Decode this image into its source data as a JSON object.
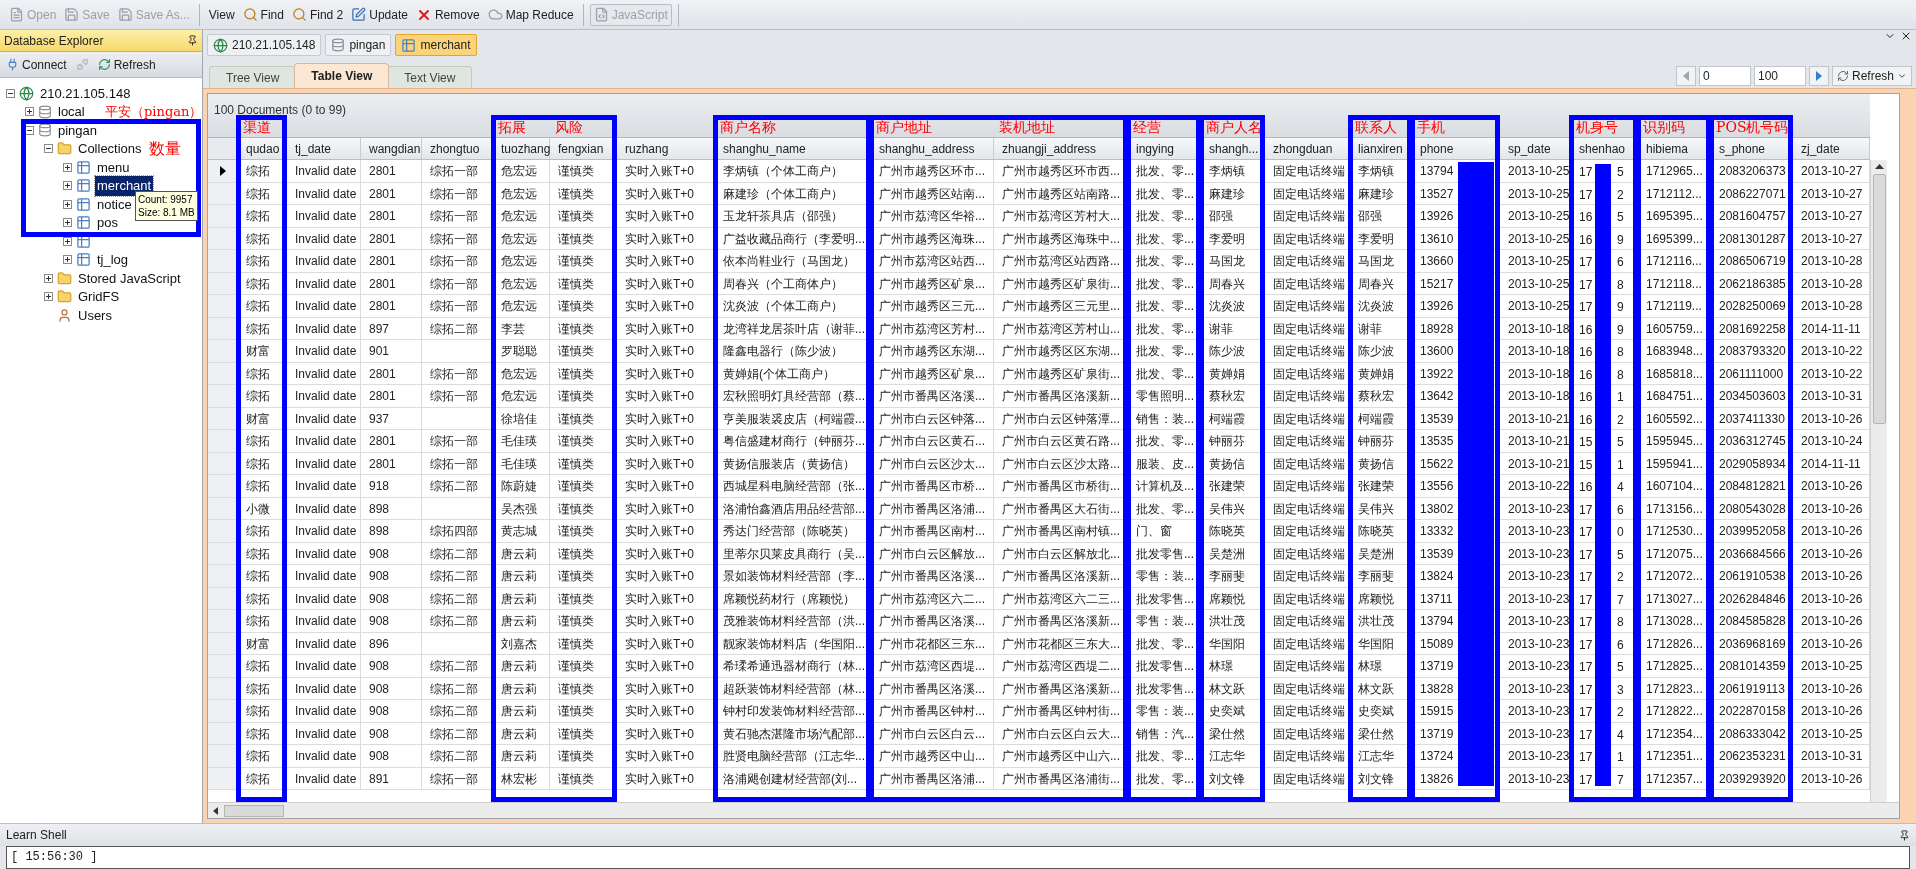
{
  "toolbar": [
    [
      {
        "label": "Open",
        "kind": "open",
        "disabled": true
      },
      {
        "label": "Save",
        "kind": "save",
        "disabled": true
      },
      {
        "label": "Save As...",
        "kind": "save",
        "disabled": true
      }
    ],
    [
      {
        "label": "View",
        "kind": "text",
        "disabled": false
      },
      {
        "label": "Find",
        "kind": "find",
        "disabled": false
      },
      {
        "label": "Find 2",
        "kind": "find",
        "disabled": false
      },
      {
        "label": "Update",
        "kind": "update",
        "disabled": false
      },
      {
        "label": "Remove",
        "kind": "remove",
        "disabled": false
      },
      {
        "label": "Map Reduce",
        "kind": "mapreduce",
        "disabled": false
      }
    ],
    [
      {
        "label": "JavaScript",
        "kind": "script",
        "disabled": true
      }
    ]
  ],
  "sidebar": {
    "title": "Database Explorer",
    "boxed": true,
    "buttons": [
      {
        "label": "Connect",
        "kind": "connect",
        "disabled": false
      },
      {
        "kind": "disconnect",
        "disabled": true
      },
      {
        "label": "Refresh",
        "kind": "refresh",
        "disabled": false
      }
    ],
    "tree": [
      {
        "label": "210.21.105.148",
        "kind": "server",
        "expanded": true,
        "children": [
          {
            "label": "local",
            "kind": "database",
            "expanded": false
          },
          {
            "label": "pingan",
            "kind": "database",
            "expanded": true,
            "callout": "平安（pingan）",
            "children": [
              {
                "label": "Collections",
                "kind": "folder",
                "expanded": true,
                "callout": "数量",
                "children": [
                  {
                    "label": "menu",
                    "kind": "collection",
                    "expanded": false,
                    "selected": false
                  },
                  {
                    "label": "merchant",
                    "kind": "collection",
                    "expanded": false,
                    "selected": true,
                    "tooltip": [
                      "Count: 9957",
                      "Size: 8.1 MB"
                    ]
                  },
                  {
                    "label": "notice",
                    "kind": "collection",
                    "expanded": false,
                    "selected": false
                  },
                  {
                    "label": "pos",
                    "kind": "collection",
                    "expanded": false,
                    "selected": false
                  },
                  {
                    "kind": "collection",
                    "expanded": false
                  },
                  {
                    "label": "tj_log",
                    "kind": "collection",
                    "expanded": false,
                    "selected": false
                  }
                ]
              },
              {
                "label": "Stored JavaScript",
                "kind": "folder",
                "expanded": false
              },
              {
                "label": "GridFS",
                "kind": "folder",
                "expanded": false
              },
              {
                "label": "Users",
                "kind": "users"
              }
            ]
          }
        ]
      }
    ]
  },
  "doc_tabs": [
    {
      "label": "210.21.105.148",
      "kind": "server",
      "selected": false
    },
    {
      "label": "pingan",
      "kind": "database",
      "selected": false
    },
    {
      "label": "merchant",
      "kind": "collection",
      "selected": true
    }
  ],
  "view_tabs": [
    {
      "label": "Tree View",
      "selected": false
    },
    {
      "label": "Table View",
      "selected": true
    },
    {
      "label": "Text View",
      "selected": false
    }
  ],
  "pager": {
    "from": "0",
    "to": "100",
    "refresh": "Refresh"
  },
  "table": {
    "count": "100 Documents (0 to 99)",
    "columns": [
      {
        "title": "qudao",
        "boxed": true,
        "callout": "渠道"
      },
      {
        "title": "tj_date",
        "boxed": false
      },
      {
        "title": "wangdian",
        "boxed": false
      },
      {
        "title": "zhongtuo",
        "boxed": false
      },
      {
        "title": "tuozhang",
        "boxed": true,
        "callout": "拓展"
      },
      {
        "title": "fengxian",
        "boxed": true,
        "joins_previous": true,
        "callout": "风险"
      },
      {
        "title": "ruzhang",
        "boxed": false
      },
      {
        "title": "shanghu_name",
        "boxed": true,
        "callout": "商户名称"
      },
      {
        "title": "shanghu_address",
        "boxed": true,
        "callout": "商户地址"
      },
      {
        "title": "zhuangji_address",
        "boxed": true,
        "joins_previous": true,
        "callout": "装机地址"
      },
      {
        "title": "ingying",
        "boxed": true,
        "callout": "经营"
      },
      {
        "title": "shangh...",
        "boxed": true,
        "callout": "商户人名"
      },
      {
        "title": "zhongduan",
        "boxed": false
      },
      {
        "title": "lianxiren",
        "boxed": true,
        "callout": "联系人"
      },
      {
        "title": "phone",
        "boxed": true,
        "callout": "手机",
        "redacted": true
      },
      {
        "title": "sp_date",
        "boxed": false
      },
      {
        "title": "shenhao",
        "boxed": true,
        "callout": "机身号",
        "redacted": true
      },
      {
        "title": "hibiema",
        "boxed": true,
        "callout": "识别码"
      },
      {
        "title": "s_phone",
        "boxed": true,
        "callout": "POS机号码"
      },
      {
        "title": "zj_date",
        "boxed": false
      }
    ],
    "rows": [
      {
        "selected": true,
        "cells": [
          "综拓",
          "Invalid date",
          "2801",
          "综拓一部",
          "危宏远",
          "谨慎类",
          "实时入账T+0",
          "李炳镇（个体工商户）",
          "广州市越秀区环市...",
          "广州市越秀区环市西...",
          "批发、零...",
          "李炳镇",
          "固定电话终端",
          "李炳镇",
          "13794",
          "2013-10-25",
          [
            "17",
            "5"
          ],
          "1712965...",
          "2083206373",
          "2013-10-27"
        ]
      },
      {
        "selected": false,
        "cells": [
          "综拓",
          "Invalid date",
          "2801",
          "综拓一部",
          "危宏远",
          "谨慎类",
          "实时入账T+0",
          "麻建珍（个体工商户）",
          "广州市越秀区站南...",
          "广州市越秀区站南路...",
          "批发、零...",
          "麻建珍",
          "固定电话终端",
          "麻建珍",
          "13527",
          "2013-10-25",
          [
            "17",
            "2"
          ],
          "1712112...",
          "2086227071",
          "2013-10-27"
        ]
      },
      {
        "selected": false,
        "cells": [
          "综拓",
          "Invalid date",
          "2801",
          "综拓一部",
          "危宏远",
          "谨慎类",
          "实时入账T+0",
          "玉龙轩茶具店（邵强）",
          "广州市荔湾区华裕...",
          "广州市荔湾区芳村大...",
          "批发、零...",
          "邵强",
          "固定电话终端",
          "邵强",
          "13926",
          "2013-10-25",
          [
            "16",
            "5"
          ],
          "1695395...",
          "2081604757",
          "2013-10-27"
        ]
      },
      {
        "selected": false,
        "cells": [
          "综拓",
          "Invalid date",
          "2801",
          "综拓一部",
          "危宏远",
          "谨慎类",
          "实时入账T+0",
          "广益收藏品商行（李爱明...",
          "广州市越秀区海珠...",
          "广州市越秀区海珠中...",
          "批发、零...",
          "李爱明",
          "固定电话终端",
          "李爱明",
          "13610",
          "2013-10-25",
          [
            "16",
            "9"
          ],
          "1695399...",
          "2081301287",
          "2013-10-27"
        ]
      },
      {
        "selected": false,
        "cells": [
          "综拓",
          "Invalid date",
          "2801",
          "综拓一部",
          "危宏远",
          "谨慎类",
          "实时入账T+0",
          "依本尚鞋业行（马国龙）",
          "广州市荔湾区站西...",
          "广州市荔湾区站西路...",
          "批发、零...",
          "马国龙",
          "固定电话终端",
          "马国龙",
          "13660",
          "2013-10-25",
          [
            "17",
            "6"
          ],
          "1712116...",
          "2086506719",
          "2013-10-28"
        ]
      },
      {
        "selected": false,
        "cells": [
          "综拓",
          "Invalid date",
          "2801",
          "综拓一部",
          "危宏远",
          "谨慎类",
          "实时入账T+0",
          "周春兴（个工商体户）",
          "广州市越秀区矿泉...",
          "广州市越秀区矿泉街...",
          "批发、零...",
          "周春兴",
          "固定电话终端",
          "周春兴",
          "15217",
          "2013-10-25",
          [
            "17",
            "8"
          ],
          "1712118...",
          "2062186385",
          "2013-10-28"
        ]
      },
      {
        "selected": false,
        "cells": [
          "综拓",
          "Invalid date",
          "2801",
          "综拓一部",
          "危宏远",
          "谨慎类",
          "实时入账T+0",
          "沈炎波（个体工商户）",
          "广州市越秀区三元...",
          "广州市越秀区三元里...",
          "批发、零...",
          "沈炎波",
          "固定电话终端",
          "沈炎波",
          "13926",
          "2013-10-25",
          [
            "17",
            "9"
          ],
          "1712119...",
          "2028250069",
          "2013-10-28"
        ]
      },
      {
        "selected": false,
        "cells": [
          "综拓",
          "Invalid date",
          "897",
          "综拓二部",
          "李芸",
          "谨慎类",
          "实时入账T+0",
          "龙湾祥龙居茶叶店（谢菲...",
          "广州市荔湾区芳村...",
          "广州市荔湾区芳村山...",
          "批发、零...",
          "谢菲",
          "固定电话终端",
          "谢菲",
          "18928",
          "2013-10-18",
          [
            "16",
            "9"
          ],
          "1605759...",
          "2081692258",
          "2014-11-11"
        ]
      },
      {
        "selected": false,
        "cells": [
          "财富",
          "Invalid date",
          "901",
          null,
          "罗聪聪",
          "谨慎类",
          "实时入账T+0",
          "隆鑫电器行（陈少波）",
          "广州市越秀区东湖...",
          "广州市越秀区区东湖...",
          "批发、零...",
          "陈少波",
          "固定电话终端",
          "陈少波",
          "13600",
          "2013-10-18",
          [
            "16",
            "8"
          ],
          "1683948...",
          "2083793320",
          "2013-10-22"
        ]
      },
      {
        "selected": false,
        "cells": [
          "综拓",
          "Invalid date",
          "2801",
          "综拓一部",
          "危宏远",
          "谨慎类",
          "实时入账T+0",
          "黄婵娟(个体工商户）",
          "广州市越秀区矿泉...",
          "广州市越秀区矿泉街...",
          "批发、零...",
          "黄婵娟",
          "固定电话终端",
          "黄婵娟",
          "13922",
          "2013-10-18",
          [
            "16",
            "8"
          ],
          "1685818...",
          "2061111000",
          "2013-10-22"
        ]
      },
      {
        "selected": false,
        "cells": [
          "综拓",
          "Invalid date",
          "2801",
          "综拓一部",
          "危宏远",
          "谨慎类",
          "实时入账T+0",
          "宏秋照明灯具经营部（蔡...",
          "广州市番禺区洛溪...",
          "广州市番禺区洛溪新...",
          "零售照明...",
          "蔡秋宏",
          "固定电话终端",
          "蔡秋宏",
          "13642",
          "2013-10-18",
          [
            "16",
            "1"
          ],
          "1684751...",
          "2034503603",
          "2013-10-31"
        ]
      },
      {
        "selected": false,
        "cells": [
          "财富",
          "Invalid date",
          "937",
          null,
          "徐培佳",
          "谨慎类",
          "实时入账T+0",
          "亨美服装裘皮店（柯端霞...",
          "广州市白云区钟落...",
          "广州市白云区钟落潭...",
          "销售：装...",
          "柯端霞",
          "固定电话终端",
          "柯端霞",
          "13539",
          "2013-10-21",
          [
            "16",
            "2"
          ],
          "1605592...",
          "2037411330",
          "2013-10-26"
        ]
      },
      {
        "selected": false,
        "cells": [
          "综拓",
          "Invalid date",
          "2801",
          "综拓一部",
          "毛佳瑛",
          "谨慎类",
          "实时入账T+0",
          "粤信盛建材商行（钟丽芬...",
          "广州市白云区黄石...",
          "广州市白云区黄石路...",
          "批发、零...",
          "钟丽芬",
          "固定电话终端",
          "钟丽芬",
          "13535",
          "2013-10-21",
          [
            "15",
            "5"
          ],
          "1595945...",
          "2036312745",
          "2013-10-24"
        ]
      },
      {
        "selected": false,
        "cells": [
          "综拓",
          "Invalid date",
          "2801",
          "综拓一部",
          "毛佳瑛",
          "谨慎类",
          "实时入账T+0",
          "黄扬信服装店（黄扬信）",
          "广州市白云区沙太...",
          "广州市白云区沙太路...",
          "服装、皮...",
          "黄扬信",
          "固定电话终端",
          "黄扬信",
          "15622",
          "2013-10-21",
          [
            "15",
            "1"
          ],
          "1595941...",
          "2029058934",
          "2014-11-11"
        ]
      },
      {
        "selected": false,
        "cells": [
          "综拓",
          "Invalid date",
          "918",
          "综拓二部",
          "陈蔚婕",
          "谨慎类",
          "实时入账T+0",
          "西城星科电脑经营部（张...",
          "广州市番禺区市桥...",
          "广州市番禺区市桥街...",
          "计算机及...",
          "张建荣",
          "固定电话终端",
          "张建荣",
          "13556",
          "2013-10-22",
          [
            "16",
            "4"
          ],
          "1607104...",
          "2084812821",
          "2013-10-26"
        ]
      },
      {
        "selected": false,
        "cells": [
          "小微",
          "Invalid date",
          "898",
          null,
          "吴杰强",
          "谨慎类",
          "实时入账T+0",
          "洛浦怡鑫酒店用品经营部...",
          "广州市番禺区洛浦...",
          "广州市番禺区大石街...",
          "批发、零...",
          "吴伟兴",
          "固定电话终端",
          "吴伟兴",
          "13802",
          "2013-10-23",
          [
            "17",
            "6"
          ],
          "1713156...",
          "2080543028",
          "2013-10-26"
        ]
      },
      {
        "selected": false,
        "cells": [
          "综拓",
          "Invalid date",
          "898",
          "综拓四部",
          "黄志城",
          "谨慎类",
          "实时入账T+0",
          "秀达门经营部（陈晓英）",
          "广州市番禺区南村...",
          "广州市番禺区南村镇...",
          "门、窗",
          "陈晓英",
          "固定电话终端",
          "陈晓英",
          "13332",
          "2013-10-23",
          [
            "17",
            "0"
          ],
          "1712530...",
          "2039952058",
          "2013-10-26"
        ]
      },
      {
        "selected": false,
        "cells": [
          "综拓",
          "Invalid date",
          "908",
          "综拓二部",
          "唐云莉",
          "谨慎类",
          "实时入账T+0",
          "里蒂尔贝莱皮具商行（吴...",
          "广州市白云区解放...",
          "广州市白云区解放北...",
          "批发零售...",
          "吴楚洲",
          "固定电话终端",
          "吴楚洲",
          "13539",
          "2013-10-23",
          [
            "17",
            "5"
          ],
          "1712075...",
          "2036684566",
          "2013-10-26"
        ]
      },
      {
        "selected": false,
        "cells": [
          "综拓",
          "Invalid date",
          "908",
          "综拓二部",
          "唐云莉",
          "谨慎类",
          "实时入账T+0",
          "景如装饰材料经营部（李...",
          "广州市番禺区洛溪...",
          "广州市番禺区洛溪新...",
          "零售：装...",
          "李丽斐",
          "固定电话终端",
          "李丽斐",
          "13824",
          "2013-10-23",
          [
            "17",
            "2"
          ],
          "1712072...",
          "2061910538",
          "2013-10-26"
        ]
      },
      {
        "selected": false,
        "cells": [
          "综拓",
          "Invalid date",
          "908",
          "综拓二部",
          "唐云莉",
          "谨慎类",
          "实时入账T+0",
          "席颖悦药材行（席颖悦）",
          "广州市荔湾区六二...",
          "广州市荔湾区六二三...",
          "批发零售...",
          "席颖悦",
          "固定电话终端",
          "席颖悦",
          "13711",
          "2013-10-23",
          [
            "17",
            "7"
          ],
          "1713027...",
          "2026284846",
          "2013-10-26"
        ]
      },
      {
        "selected": false,
        "cells": [
          "综拓",
          "Invalid date",
          "908",
          "综拓二部",
          "唐云莉",
          "谨慎类",
          "实时入账T+0",
          "茂雅装饰材料经营部（洪...",
          "广州市番禺区洛溪...",
          "广州市番禺区洛溪新...",
          "零售：装...",
          "洪壮茂",
          "固定电话终端",
          "洪壮茂",
          "13794",
          "2013-10-23",
          [
            "17",
            "8"
          ],
          "1713028...",
          "2084585828",
          "2013-10-26"
        ]
      },
      {
        "selected": false,
        "cells": [
          "财富",
          "Invalid date",
          "896",
          null,
          "刘嘉杰",
          "谨慎类",
          "实时入账T+0",
          "靓家装饰材料店（华国阳...",
          "广州市花都区三东...",
          "广州市花都区三东大...",
          "批发、零...",
          "华国阳",
          "固定电话终端",
          "华国阳",
          "15089",
          "2013-10-23",
          [
            "17",
            "6"
          ],
          "1712826...",
          "2036968169",
          "2013-10-26"
        ]
      },
      {
        "selected": false,
        "cells": [
          "综拓",
          "Invalid date",
          "908",
          "综拓二部",
          "唐云莉",
          "谨慎类",
          "实时入账T+0",
          "希瑈希通迅器材商行（林...",
          "广州市荔湾区西堤...",
          "广州市荔湾区西堤二...",
          "批发零售...",
          "林璟",
          "固定电话终端",
          "林璟",
          "13719",
          "2013-10-23",
          [
            "17",
            "5"
          ],
          "1712825...",
          "2081014359",
          "2013-10-25"
        ]
      },
      {
        "selected": false,
        "cells": [
          "综拓",
          "Invalid date",
          "908",
          "综拓二部",
          "唐云莉",
          "谨慎类",
          "实时入账T+0",
          "超跃装饰材料经营部（林...",
          "广州市番禺区洛溪...",
          "广州市番禺区洛溪新...",
          "批发零售...",
          "林文跃",
          "固定电话终端",
          "林文跃",
          "13828",
          "2013-10-23",
          [
            "17",
            "3"
          ],
          "1712823...",
          "2061919113",
          "2013-10-26"
        ]
      },
      {
        "selected": false,
        "cells": [
          "综拓",
          "Invalid date",
          "908",
          "综拓二部",
          "唐云莉",
          "谨慎类",
          "实时入账T+0",
          "钟村印发装饰材料经营部...",
          "广州市番禺区钟村...",
          "广州市番禺区钟村街...",
          "零售：装...",
          "史奕斌",
          "固定电话终端",
          "史奕斌",
          "15915",
          "2013-10-23",
          [
            "17",
            "2"
          ],
          "1712822...",
          "2022870158",
          "2013-10-26"
        ]
      },
      {
        "selected": false,
        "cells": [
          "综拓",
          "Invalid date",
          "908",
          "综拓二部",
          "唐云莉",
          "谨慎类",
          "实时入账T+0",
          "黄石驰杰湛隆市场汽配部...",
          "广州市白云区白云...",
          "广州市白云区白云大...",
          "销售：汽...",
          "梁仕然",
          "固定电话终端",
          "梁仕然",
          "13719",
          "2013-10-23",
          [
            "17",
            "4"
          ],
          "1712354...",
          "2086333042",
          "2013-10-25"
        ]
      },
      {
        "selected": false,
        "cells": [
          "综拓",
          "Invalid date",
          "908",
          "综拓二部",
          "唐云莉",
          "谨慎类",
          "实时入账T+0",
          "胜贤电脑经营部（江志华...",
          "广州市越秀区中山...",
          "广州市越秀区中山六...",
          "批发、零...",
          "江志华",
          "固定电话终端",
          "江志华",
          "13724",
          "2013-10-23",
          [
            "17",
            "1"
          ],
          "1712351...",
          "2062353231",
          "2013-10-31"
        ]
      },
      {
        "selected": false,
        "cells": [
          "综拓",
          "Invalid date",
          "891",
          "综拓一部",
          "林宏彬",
          "谨慎类",
          "实时入账T+0",
          "洛浦飓创建材经营部(刘...",
          "广州市番禺区洛浦...",
          "广州市番禺区洛浦街...",
          "批发、零...",
          "刘文锋",
          "固定电话终端",
          "刘文锋",
          "13826",
          "2013-10-23",
          [
            "17",
            "7"
          ],
          "1712357...",
          "2039293920",
          "2013-10-26"
        ]
      }
    ]
  },
  "shell": {
    "title": "Learn Shell",
    "output": "[ 15:56:30 ]"
  }
}
